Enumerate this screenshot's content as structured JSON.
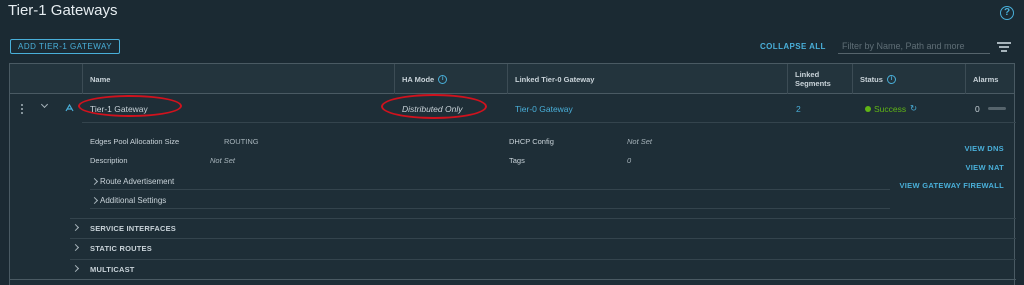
{
  "page": {
    "title": "Tier-1 Gateways",
    "help_glyph": "?"
  },
  "toolbar": {
    "add_label": "ADD TIER-1 GATEWAY",
    "collapse_label": "COLLAPSE ALL",
    "filter_placeholder": "Filter by Name, Path and more"
  },
  "grid": {
    "columns": {
      "name": "Name",
      "ha_mode": "HA Mode",
      "linked_tier0": "Linked Tier-0 Gateway",
      "linked_segments_line1": "Linked",
      "linked_segments_line2": "Segments",
      "status": "Status",
      "alarms": "Alarms"
    },
    "info_glyph": "i",
    "row": {
      "name": "Tier-1 Gateway",
      "ha_mode": "Distributed Only",
      "linked_tier0": "Tier-0 Gateway",
      "linked_segments": "2",
      "status": "Success",
      "alarms": "0",
      "refresh_glyph": "↻"
    },
    "details": {
      "edges_pool_label": "Edges Pool Allocation Size",
      "edges_pool_value": "ROUTING",
      "description_label": "Description",
      "description_value": "Not Set",
      "dhcp_label": "DHCP Config",
      "dhcp_value": "Not Set",
      "tags_label": "Tags",
      "tags_value": "0",
      "route_advertisement": "Route Advertisement",
      "additional_settings": "Additional Settings"
    },
    "side_links": {
      "view_dns": "VIEW DNS",
      "view_nat": "VIEW NAT",
      "view_firewall": "VIEW GATEWAY FIREWALL"
    },
    "sections": [
      "SERVICE INTERFACES",
      "STATIC ROUTES",
      "MULTICAST"
    ]
  },
  "colors": {
    "background": "#1b2a33",
    "accent": "#49afd9",
    "success": "#60b515",
    "annotation": "#d0121d"
  }
}
